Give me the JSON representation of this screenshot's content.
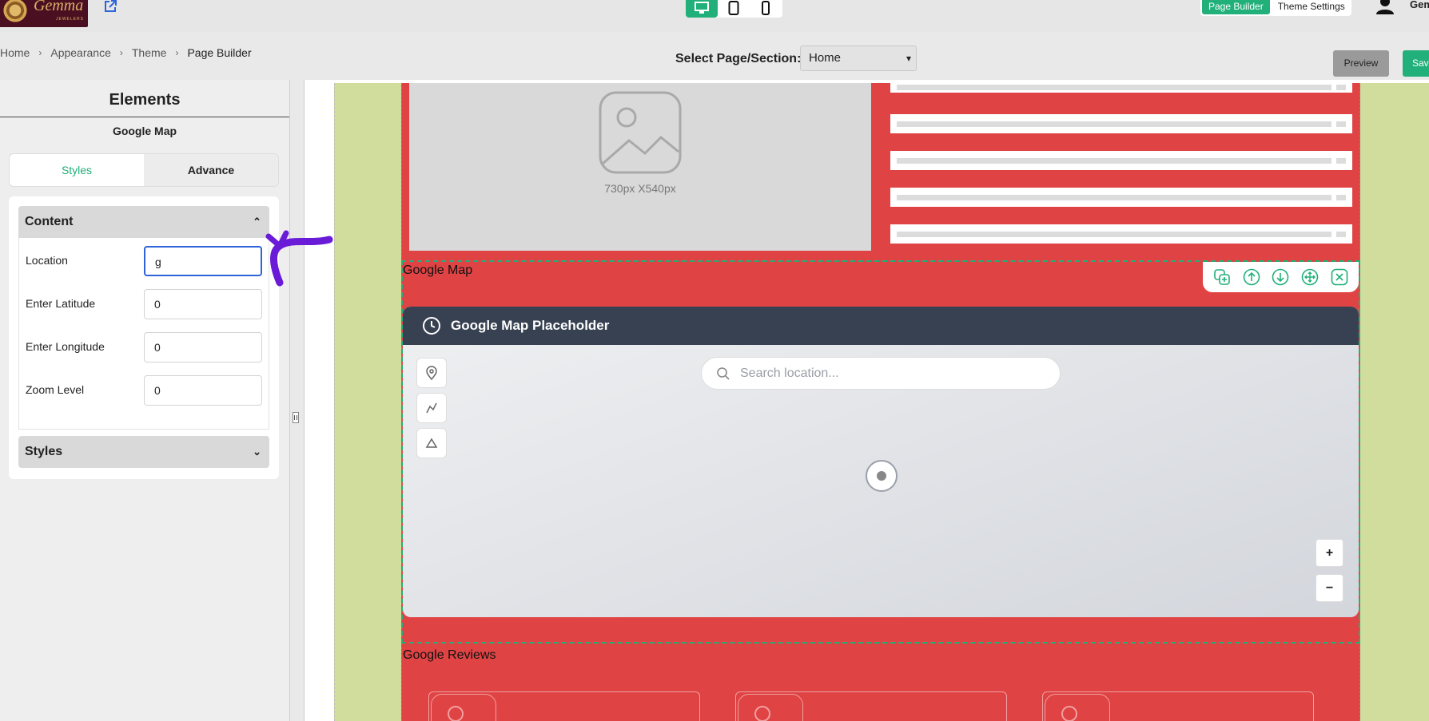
{
  "topbar": {
    "brand": "Gemma",
    "brand_sub": "JEWELERS",
    "tabs": [
      "Page Builder",
      "Theme Settings"
    ],
    "user_name": "Gem",
    "devices": [
      "desktop-icon",
      "tablet-icon",
      "mobile-icon"
    ]
  },
  "breadcrumb": [
    "Home",
    "Appearance",
    "Theme",
    "Page Builder"
  ],
  "toolbar": {
    "select_label": "Select Page/Section:",
    "selected_page": "Home",
    "preview_label": "Preview",
    "save_label": "Sav"
  },
  "panel": {
    "title": "Elements",
    "subtitle": "Google Map",
    "tabs": [
      "Styles",
      "Advance"
    ],
    "content_header": "Content",
    "fields": [
      {
        "label": "Location",
        "value": "g"
      },
      {
        "label": "Enter Latitude",
        "value": "0"
      },
      {
        "label": "Enter Longitude",
        "value": "0"
      },
      {
        "label": "Zoom Level",
        "value": "0"
      }
    ],
    "styles_header": "Styles"
  },
  "canvas": {
    "image_placeholder_label": "730px X540px",
    "map_section_label": "Google Map",
    "map_title": "Google Map Placeholder",
    "search_placeholder": "Search location...",
    "zoom_in": "+",
    "zoom_out": "−",
    "reviews_section_label": "Google Reviews"
  },
  "colors": {
    "accent": "#21b07a",
    "section_bg": "#e04344",
    "outer_bg": "#d0dd9c",
    "map_header": "#374151",
    "focus": "#2e63d9"
  }
}
